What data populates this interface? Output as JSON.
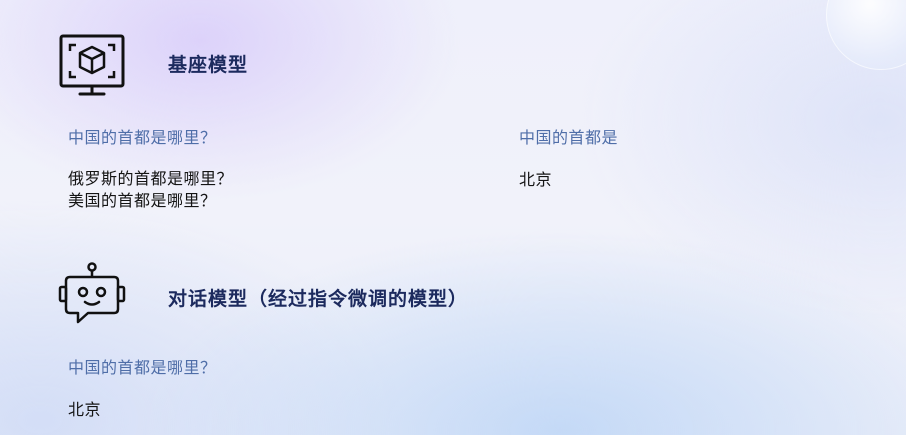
{
  "base_model": {
    "icon": "cube-monitor-icon",
    "title": "基座模型",
    "left_prompt": "中国的首都是哪里？",
    "left_output_lines": [
      "俄罗斯的首都是哪里？",
      "美国的首都是哪里？"
    ],
    "right_prompt": "中国的首都是",
    "right_output": "北京"
  },
  "chat_model": {
    "icon": "robot-chat-icon",
    "title": "对话模型（经过指令微调的模型）",
    "prompt": "中国的首都是哪里？",
    "output": "北京"
  },
  "colors": {
    "heading": "#1c2a5e",
    "prompt": "#4f6ea8",
    "answer": "#141414",
    "icon": "#111111"
  }
}
